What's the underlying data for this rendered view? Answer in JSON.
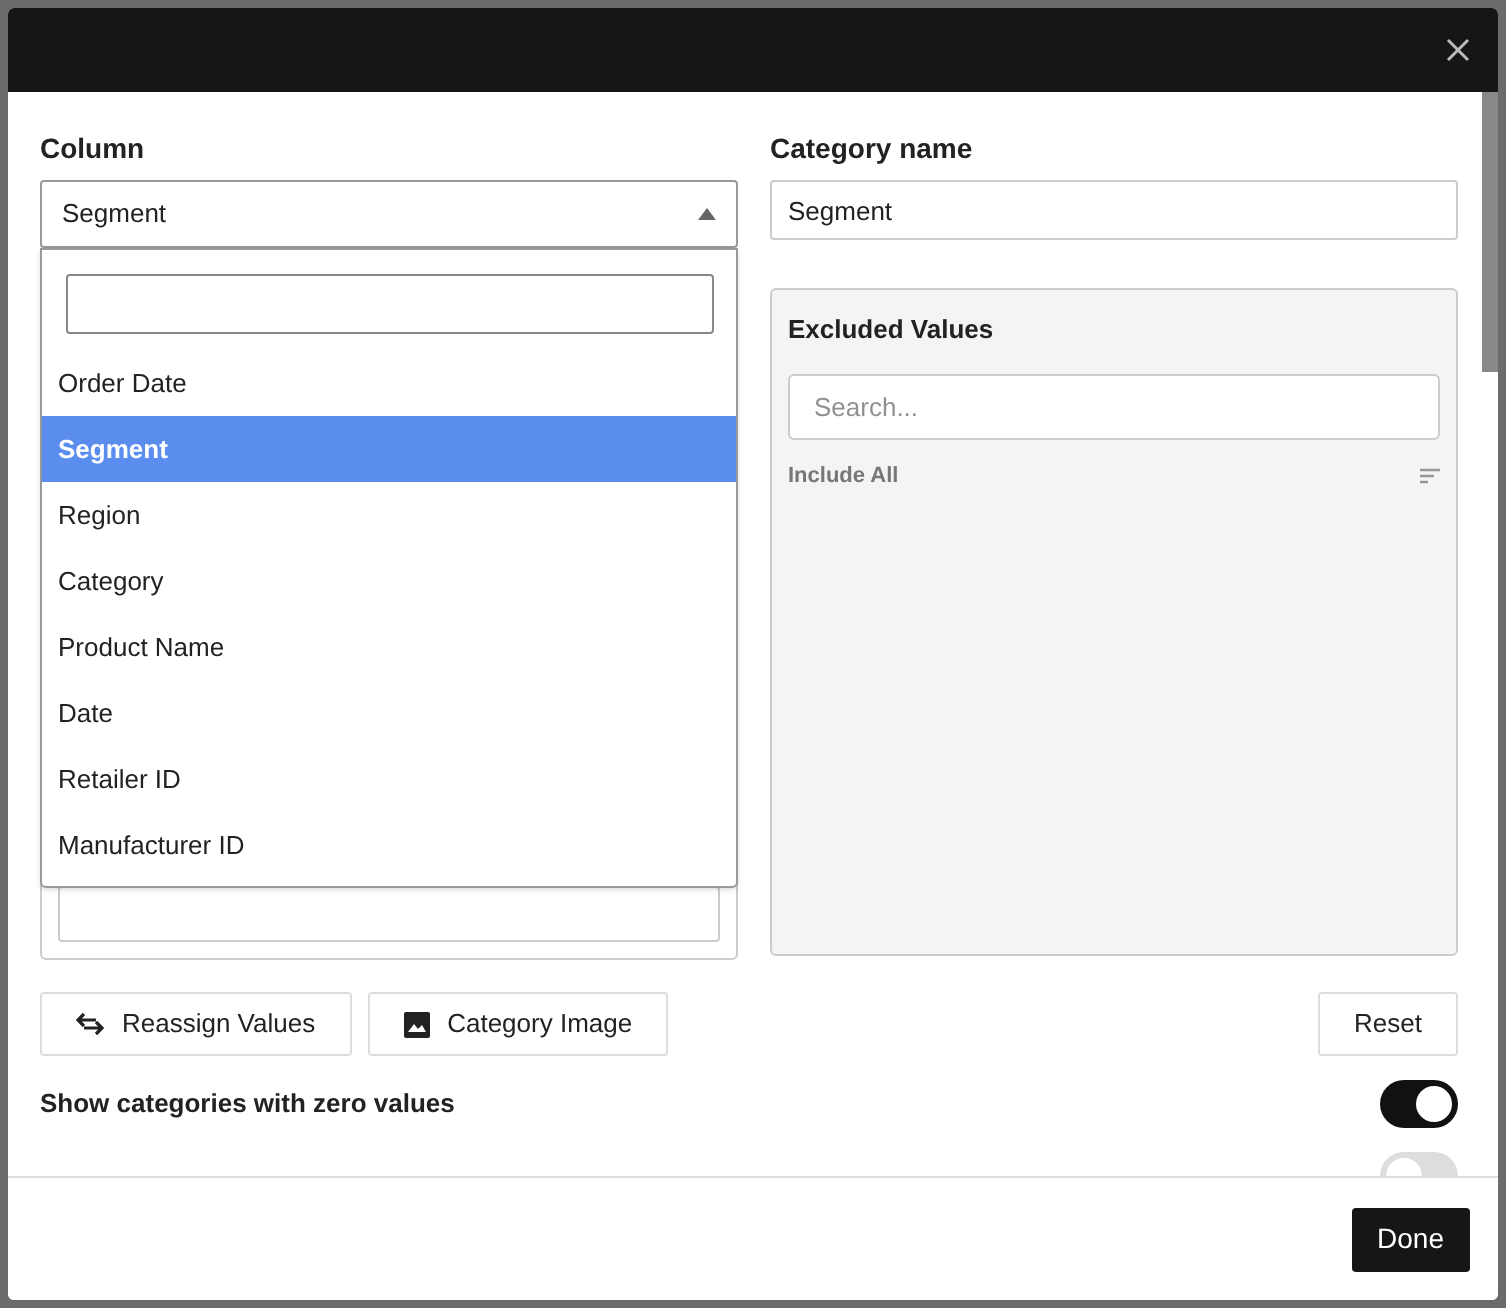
{
  "column": {
    "label": "Column",
    "value": "Segment",
    "expanded": true,
    "options": [
      {
        "label": "Order Date",
        "selected": false
      },
      {
        "label": "Segment",
        "selected": true
      },
      {
        "label": "Region",
        "selected": false
      },
      {
        "label": "Category",
        "selected": false
      },
      {
        "label": "Product Name",
        "selected": false
      },
      {
        "label": "Date",
        "selected": false
      },
      {
        "label": "Retailer ID",
        "selected": false
      },
      {
        "label": "Manufacturer ID",
        "selected": false
      }
    ]
  },
  "category_name": {
    "label": "Category name",
    "value": "Segment"
  },
  "excluded": {
    "title": "Excluded Values",
    "placeholder": "Search...",
    "include_all": "Include All"
  },
  "buttons": [
    {
      "label": "Reassign Values",
      "kind": "swap"
    },
    {
      "label": "Category Image",
      "kind": "image"
    }
  ],
  "reset": "Reset",
  "toggles": [
    {
      "label": "Show categories with zero values",
      "on": true
    },
    {
      "on": false
    }
  ],
  "done": "Done"
}
